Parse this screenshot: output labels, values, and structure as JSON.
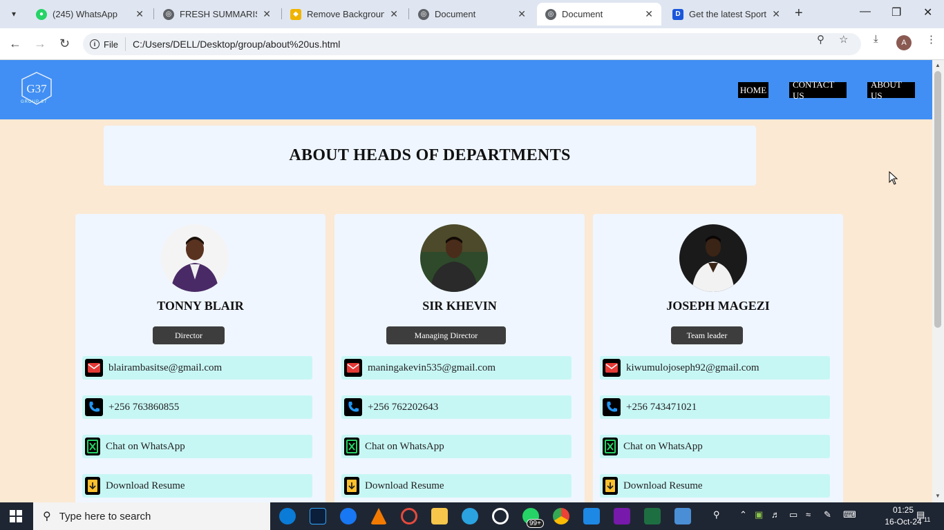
{
  "browser": {
    "tabs": [
      {
        "title": "(245) WhatsApp",
        "favicon": "whatsapp-icon",
        "active": false
      },
      {
        "title": "FRESH SUMMARISED",
        "favicon": "globe-icon",
        "active": false
      },
      {
        "title": "Remove Background",
        "favicon": "removebg-icon",
        "active": false
      },
      {
        "title": "Document",
        "favicon": "globe-icon",
        "active": false
      },
      {
        "title": "Document",
        "favicon": "globe-icon",
        "active": true
      },
      {
        "title": "Get the latest Sport, I",
        "favicon": "dstv-icon",
        "active": false
      }
    ],
    "address": {
      "scheme_label": "File",
      "url": "C:/Users/DELL/Desktop/group/about%20us.html"
    },
    "profile_initial": "A"
  },
  "site": {
    "nav": [
      "HOME",
      "CONTACT US",
      "ABOUT US"
    ],
    "heading": "ABOUT HEADS OF DEPARTMENTS",
    "logo_text": "GROUP 37",
    "logo_mark": "G37"
  },
  "people": [
    {
      "name": "TONNY BLAIR",
      "role": "Director",
      "email": "blairambasitse@gmail.com",
      "phone": "+256 763860855",
      "whatsapp": "Chat on WhatsApp",
      "resume": "Download Resume",
      "suit_color": "#4a2a66"
    },
    {
      "name": "SIR KHEVIN",
      "role": "Managing Director",
      "email": "maningakevin535@gmail.com",
      "phone": "+256 762202643",
      "whatsapp": "Chat on WhatsApp",
      "resume": "Download Resume",
      "suit_color": "#2a2a2a"
    },
    {
      "name": "JOSEPH MAGEZI",
      "role": "Team leader",
      "email": "kiwumulojoseph92@gmail.com",
      "phone": "+256 743471021",
      "whatsapp": "Chat on WhatsApp",
      "resume": "Download Resume",
      "suit_color": "#f2f2f2"
    }
  ],
  "taskbar": {
    "search_placeholder": "Type here to search",
    "time": "01:25",
    "date": "16-Oct-24",
    "badge": "99+",
    "notification_count": "11"
  },
  "colors": {
    "header_bg": "#418ff4",
    "page_bg": "#fbe9d4",
    "card_bg": "#eff6ff",
    "row_bg": "#c7f7f5",
    "email_icon": "#e53935",
    "phone_icon": "#2196f3",
    "whatsapp_icon": "#25d366",
    "resume_icon": "#fbc02d"
  }
}
